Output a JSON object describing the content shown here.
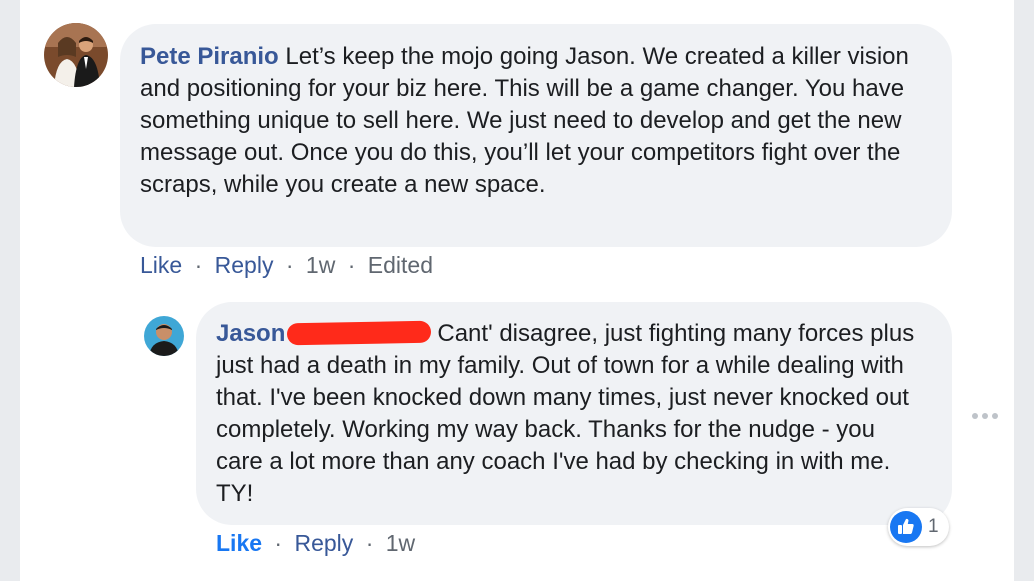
{
  "comments": [
    {
      "author": "Pete Piranio",
      "text": "Let’s keep the mojo going Jason. We created a killer vision and positioning for your biz here. This will be a game changer. You have something unique to sell here. We just need to develop and get the new message out. Once you do this, you’ll let your competitors fight over the scraps, while you create a new space.",
      "actions": {
        "like": "Like",
        "reply": "Reply",
        "time": "1w",
        "edited": "Edited",
        "separator": "·"
      }
    },
    {
      "author": "Jason",
      "text": "Cant' disagree, just fighting many forces plus just had a death in my family. Out of town for a while dealing with that. I've been knocked down many times, just never knocked out completely. Working my way back. Thanks for the nudge - you care a lot more than any coach I've had by checking in with me. TY!",
      "actions": {
        "like": "Like",
        "reply": "Reply",
        "time": "1w",
        "separator": "·"
      },
      "reactions": {
        "count": "1",
        "icon": "thumbs-up-icon"
      }
    }
  ],
  "colors": {
    "author": "#385898",
    "liked": "#1877f2",
    "bubble": "#f0f2f5",
    "redaction": "#ff2a1a"
  }
}
